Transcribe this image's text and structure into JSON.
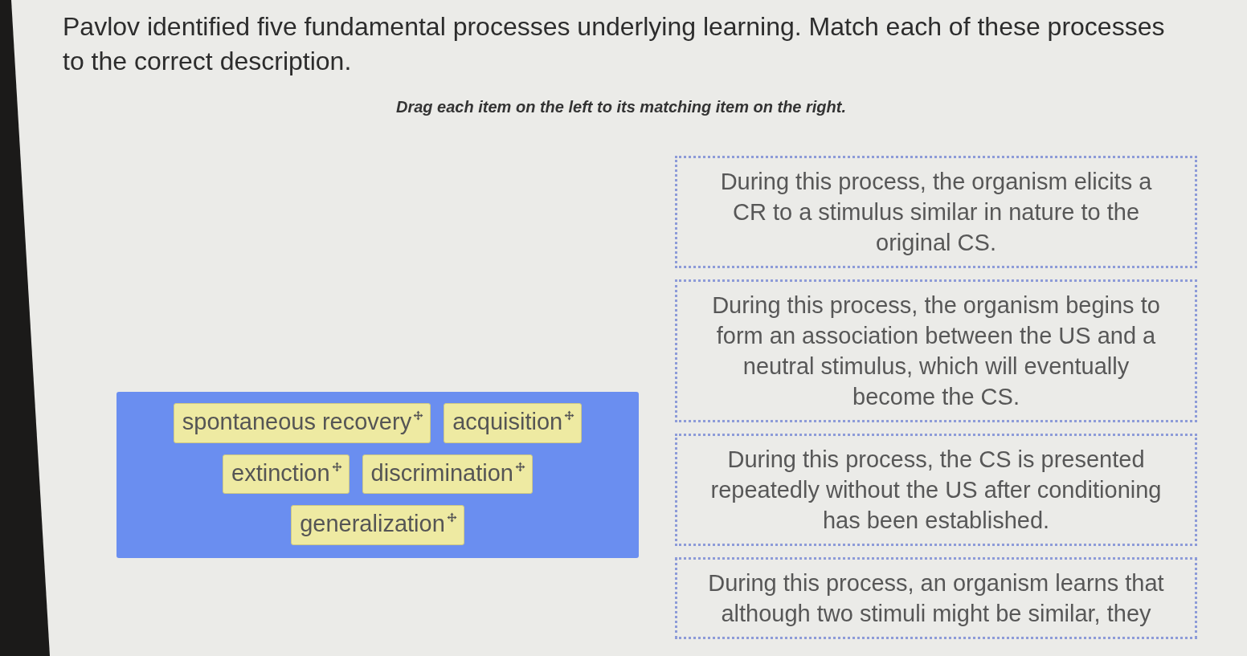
{
  "question": {
    "prompt": "Pavlov identified five fundamental processes underlying learning. Match each of these processes to the correct description.",
    "instruction": "Drag each item on the left to its matching item on the right."
  },
  "drag_items": [
    {
      "label": "spontaneous recovery"
    },
    {
      "label": "acquisition"
    },
    {
      "label": "extinction"
    },
    {
      "label": "discrimination"
    },
    {
      "label": "generalization"
    }
  ],
  "targets": [
    {
      "text": "During this process, the organism elicits a CR to a stimulus similar in nature to the original CS."
    },
    {
      "text": "During this process, the organism begins to form an association between the US and a neutral stimulus, which will eventually become the CS."
    },
    {
      "text": "During this process, the CS is presented repeatedly without the US after conditioning has been established."
    },
    {
      "text": "During this process, an organism learns that although two stimuli might be similar, they"
    }
  ]
}
